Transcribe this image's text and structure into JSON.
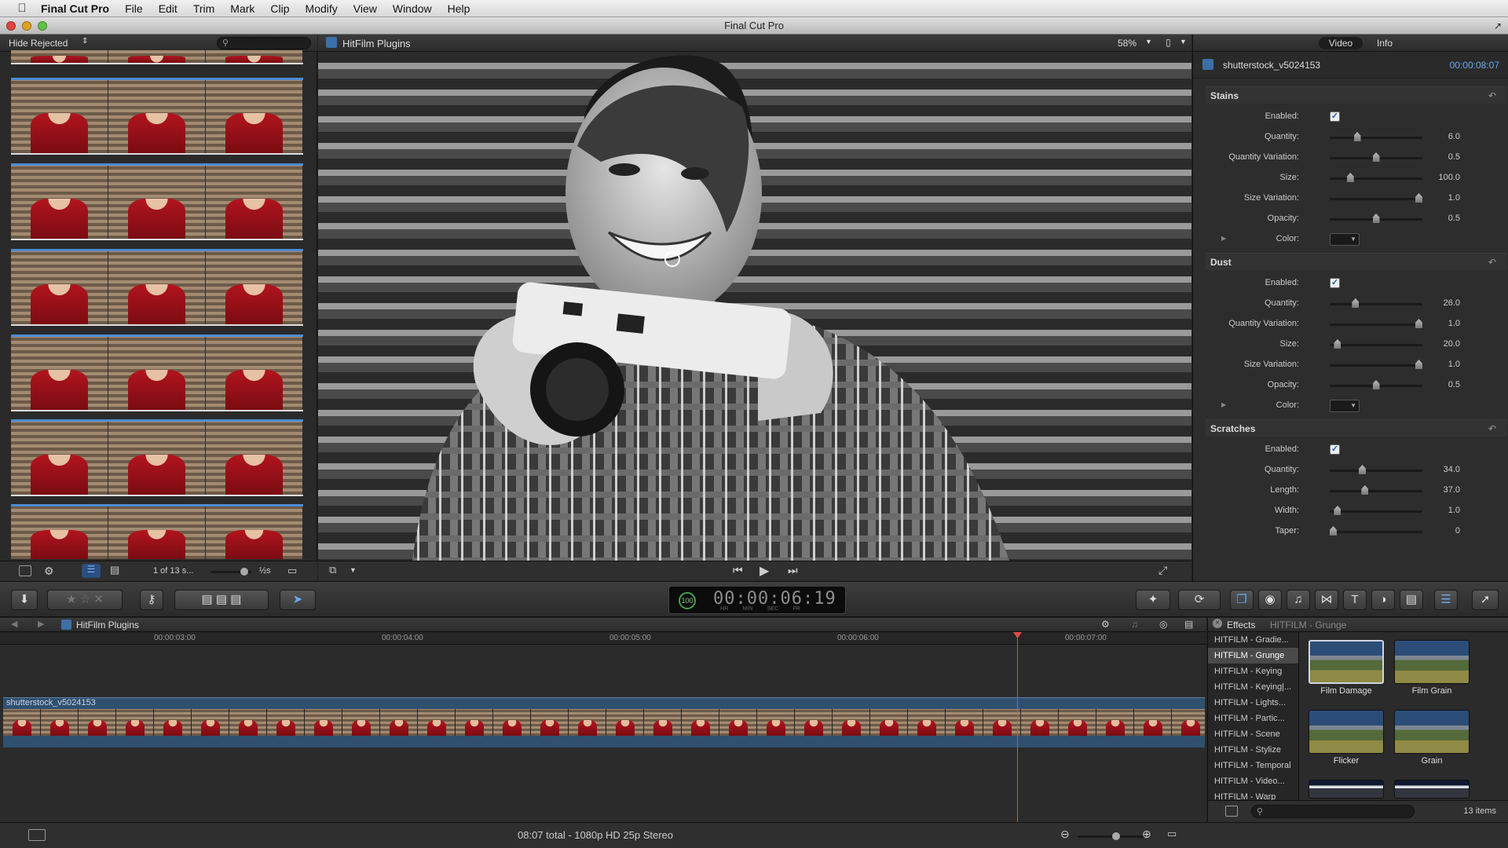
{
  "menubar": {
    "app_name": "Final Cut Pro",
    "items": [
      "File",
      "Edit",
      "Trim",
      "Mark",
      "Clip",
      "Modify",
      "View",
      "Window",
      "Help"
    ]
  },
  "window": {
    "title": "Final Cut Pro"
  },
  "browser": {
    "filter_label": "Hide Rejected",
    "footer_count": "1 of 13 s...",
    "duration_label": "½s"
  },
  "viewer": {
    "title": "HitFilm Plugins",
    "zoom": "58%"
  },
  "inspector": {
    "tabs": [
      "Video",
      "Info"
    ],
    "active_tab": "Video",
    "clip_name": "shutterstock_v5024153",
    "clip_timecode": "00:00:08:07",
    "sections": [
      {
        "title": "Stains",
        "rows": [
          {
            "label": "Enabled:",
            "type": "check"
          },
          {
            "label": "Quantity:",
            "type": "slider",
            "value": "6.0",
            "level": 0.28
          },
          {
            "label": "Quantity Variation:",
            "type": "slider",
            "value": "0.5",
            "level": 0.5
          },
          {
            "label": "Size:",
            "type": "slider",
            "value": "100.0",
            "level": 0.2
          },
          {
            "label": "Size Variation:",
            "type": "slider",
            "value": "1.0",
            "level": 1.0
          },
          {
            "label": "Opacity:",
            "type": "slider",
            "value": "0.5",
            "level": 0.5
          },
          {
            "label": "Color:",
            "type": "color"
          }
        ]
      },
      {
        "title": "Dust",
        "rows": [
          {
            "label": "Enabled:",
            "type": "check"
          },
          {
            "label": "Quantity:",
            "type": "slider",
            "value": "26.0",
            "level": 0.26
          },
          {
            "label": "Quantity Variation:",
            "type": "slider",
            "value": "1.0",
            "level": 1.0
          },
          {
            "label": "Size:",
            "type": "slider",
            "value": "20.0",
            "level": 0.05
          },
          {
            "label": "Size Variation:",
            "type": "slider",
            "value": "1.0",
            "level": 1.0
          },
          {
            "label": "Opacity:",
            "type": "slider",
            "value": "0.5",
            "level": 0.5
          },
          {
            "label": "Color:",
            "type": "color"
          }
        ]
      },
      {
        "title": "Scratches",
        "rows": [
          {
            "label": "Enabled:",
            "type": "check"
          },
          {
            "label": "Quantity:",
            "type": "slider",
            "value": "34.0",
            "level": 0.34
          },
          {
            "label": "Length:",
            "type": "slider",
            "value": "37.0",
            "level": 0.37
          },
          {
            "label": "Width:",
            "type": "slider",
            "value": "1.0",
            "level": 0.05
          },
          {
            "label": "Taper:",
            "type": "slider",
            "value": "0",
            "level": 0.0
          }
        ]
      }
    ]
  },
  "toolbar": {
    "timecode": "00:00:06:19",
    "timecode_units": [
      "HR",
      "MIN",
      "SEC",
      "FR"
    ],
    "timecode_badge": "100"
  },
  "timeline": {
    "title": "HitFilm Plugins",
    "ruler": [
      "00:00:03:00",
      "00:00:04:00",
      "00:00:05:00",
      "00:00:06:00",
      "00:00:07:00"
    ],
    "clip_name": "shutterstock_v5024153"
  },
  "effects": {
    "title": "Effects",
    "subtitle": "HITFILM - Grunge",
    "categories": [
      "HITFILM - Gradie...",
      "HITFILM - Grunge",
      "HITFILM - Keying",
      "HITFILM - Keying|...",
      "HITFILM - Lights...",
      "HITFILM - Partic...",
      "HITFILM - Scene",
      "HITFILM - Stylize",
      "HITFILM - Temporal",
      "HITFILM - Video...",
      "HITFILM - Warp"
    ],
    "selected_category": "HITFILM - Grunge",
    "thumbs": [
      "Film Damage",
      "Film Grain",
      "Flicker",
      "Grain"
    ],
    "items_count": "13 items"
  },
  "status": {
    "summary": "08:07 total - 1080p HD 25p Stereo"
  }
}
